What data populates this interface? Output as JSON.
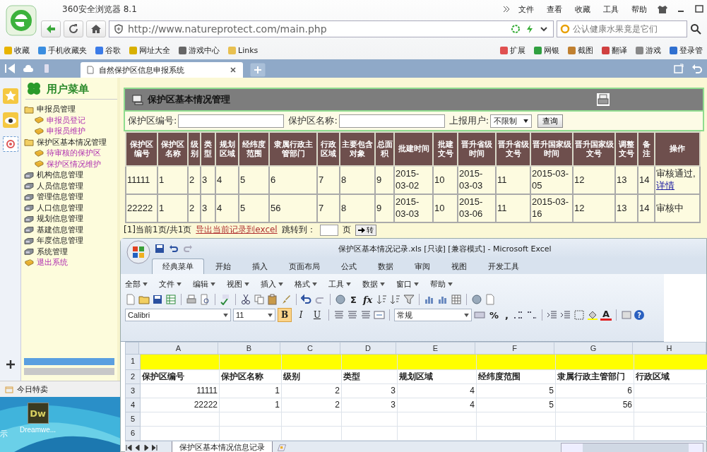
{
  "browser": {
    "title": "360安全浏览器 8.1",
    "menu": [
      "文件",
      "查看",
      "收藏",
      "工具",
      "帮助"
    ],
    "address": "http://www.natureprotect.com/main.php",
    "search_placeholder": "公认健康水果竟是它们",
    "bookmarks": [
      "收藏",
      "手机收藏夹",
      "谷歌",
      "网址大全",
      "游戏中心",
      "Links"
    ],
    "extensions": [
      "扩展",
      "网银",
      "截图",
      "翻译",
      "游戏",
      "登录管"
    ],
    "tabs": [
      {
        "label": "自然保护区信息申报系统",
        "selected": true
      }
    ]
  },
  "menu": {
    "title": "用户菜单",
    "items": [
      {
        "label": "申报员管理",
        "kind": "folder",
        "children": [
          {
            "label": "申报员登记",
            "kind": "book"
          },
          {
            "label": "申报员维护",
            "kind": "book"
          }
        ]
      },
      {
        "label": "保护区基本情况管理",
        "kind": "folder",
        "children": [
          {
            "label": "待审核的保护区",
            "kind": "book"
          },
          {
            "label": "保护区情况维护",
            "kind": "book"
          }
        ]
      },
      {
        "label": "机构信息管理",
        "kind": "drawer"
      },
      {
        "label": "人员信息管理",
        "kind": "drawer"
      },
      {
        "label": "管理信息管理",
        "kind": "drawer"
      },
      {
        "label": "人口信息管理",
        "kind": "drawer"
      },
      {
        "label": "规划信息管理",
        "kind": "drawer"
      },
      {
        "label": "基建信息管理",
        "kind": "drawer"
      },
      {
        "label": "年度信息管理",
        "kind": "drawer"
      },
      {
        "label": "系统管理",
        "kind": "drawer"
      },
      {
        "label": "退出系统",
        "kind": "book"
      }
    ]
  },
  "sidebar_bottom": "今日特卖",
  "desktop": {
    "edge_text": "示",
    "icon_text": "Dw",
    "icon_label": "Dreamwe..."
  },
  "panel": {
    "title": "保护区基本情况管理",
    "filters": [
      {
        "label": "保护区编号:",
        "kind": "text"
      },
      {
        "label": "保护区名称:",
        "kind": "text"
      },
      {
        "label": "上报用户:",
        "kind": "select",
        "value": "不限制"
      }
    ],
    "query_button": "查询",
    "table": {
      "columns": [
        "保护区编号",
        "保护区名称",
        "级别",
        "类型",
        "规划区域",
        "经纬度范围",
        "隶属行政主管部门",
        "行政区域",
        "主要包含对象",
        "总面积",
        "批建时间",
        "批建文号",
        "晋升省级时间",
        "晋升省级文号",
        "晋升国家级时间",
        "晋升国家级文号",
        "调整文号",
        "备注",
        "操作"
      ],
      "rows": [
        {
          "cells": [
            "11111",
            "1",
            "2",
            "3",
            "4",
            "5",
            "6",
            "7",
            "8",
            "9",
            "2015-03-02",
            "10",
            "2015-03-03",
            "11",
            "2015-03-05",
            "12",
            "13",
            "14"
          ],
          "status": "审核通过,",
          "link": "详情"
        },
        {
          "cells": [
            "22222",
            "1",
            "2",
            "3",
            "4",
            "5",
            "56",
            "7",
            "8",
            "9",
            "2015-03-03",
            "10",
            "2015-03-06",
            "11",
            "2015-03-16",
            "12",
            "13",
            "14"
          ],
          "status": "审核中"
        }
      ]
    },
    "footer": {
      "page_info": "[1]当前1页/共1页",
      "export_link": "导出当前记录到excel",
      "jump_label": "跳转到：",
      "page_unit": "页",
      "go_button": "转"
    }
  },
  "excel": {
    "title": "保护区基本情况记录.xls  [只读]  [兼容模式] - Microsoft Excel",
    "ribbon_tabs": [
      {
        "label": "经典菜单",
        "selected": true
      },
      {
        "label": "开始",
        "selected": false
      },
      {
        "label": "插入",
        "selected": false
      },
      {
        "label": "页面布局",
        "selected": false
      },
      {
        "label": "公式",
        "selected": false
      },
      {
        "label": "数据",
        "selected": false
      },
      {
        "label": "审阅",
        "selected": false
      },
      {
        "label": "视图",
        "selected": false
      },
      {
        "label": "开发工具",
        "selected": false
      }
    ],
    "menus": [
      "全部",
      "文件",
      "编辑",
      "视图",
      "插入",
      "格式",
      "工具",
      "数据",
      "窗口",
      "帮助"
    ],
    "font": "Calibri",
    "font_size": "11",
    "format_buttons": [
      {
        "label": "B",
        "on": true
      },
      {
        "label": "I",
        "on": false
      },
      {
        "label": "U",
        "on": false
      }
    ],
    "number_format": "常规",
    "symbols": {
      "sum": "Σ",
      "function": "fx",
      "percent": "%",
      "comma": ",",
      "font_color": "A",
      "help": "?"
    },
    "columns": [
      "A",
      "B",
      "C",
      "D",
      "E",
      "F",
      "G",
      "H"
    ],
    "rows": [
      {
        "number": "1",
        "kind": "blank",
        "highlight": true
      },
      {
        "number": "2",
        "kind": "header",
        "highlight": false,
        "cells": [
          "保护区编号",
          "保护区名称",
          "级别",
          "类型",
          "规划区域",
          "经纬度范围",
          "隶属行政主管部门",
          "行政区域"
        ]
      },
      {
        "number": "3",
        "kind": "data",
        "highlight": false,
        "cells": [
          "11111",
          "1",
          "2",
          "3",
          "4",
          "5",
          "6"
        ]
      },
      {
        "number": "4",
        "kind": "data",
        "highlight": false,
        "cells": [
          "22222",
          "1",
          "2",
          "3",
          "4",
          "5",
          "56"
        ]
      },
      {
        "number": "5",
        "kind": "blank",
        "highlight": false
      },
      {
        "number": "6",
        "kind": "blank",
        "highlight": false
      }
    ],
    "sheet_tabs": [
      {
        "label": "保护区基本情况信息记录",
        "selected": true
      }
    ]
  }
}
